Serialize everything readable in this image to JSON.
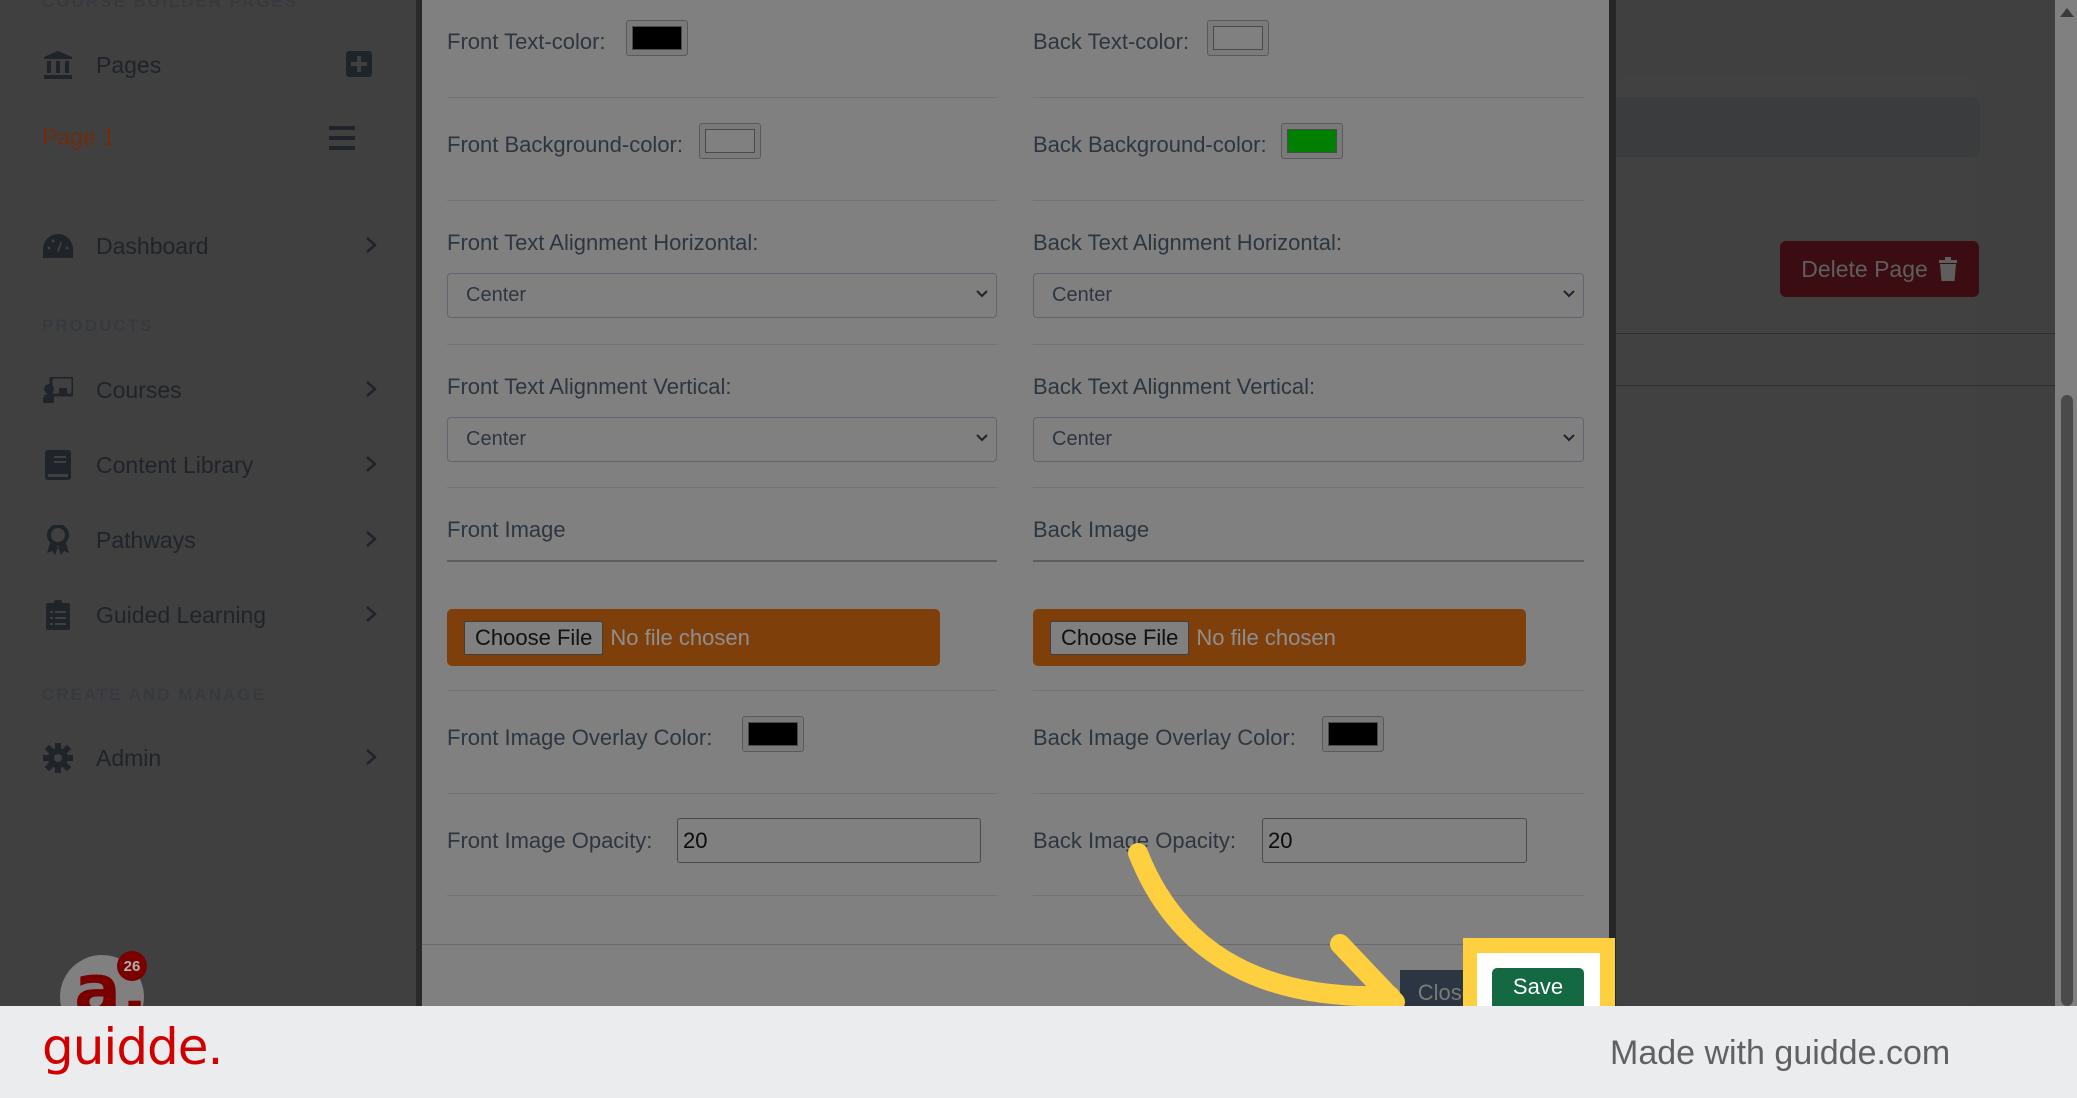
{
  "sidebar": {
    "section_course_builder": "COURSE BUILDER PAGES",
    "pages_label": "Pages",
    "page1_label": "Page 1",
    "dashboard_label": "Dashboard",
    "section_products": "PRODUCTS",
    "items": [
      {
        "label": "Courses",
        "icon": "chalkboard-teacher-icon"
      },
      {
        "label": "Content Library",
        "icon": "book-icon"
      },
      {
        "label": "Pathways",
        "icon": "award-icon"
      },
      {
        "label": "Guided Learning",
        "icon": "clipboard-list-icon"
      }
    ],
    "section_create": "CREATE AND MANAGE",
    "admin_label": "Admin",
    "notification_count": "26"
  },
  "main": {
    "delete_page_label": "Delete Page"
  },
  "modal": {
    "front": {
      "text_color_label": "Front Text-color:",
      "text_color_value": "#000000",
      "bg_color_label": "Front Background-color:",
      "bg_color_value": "#ffffff",
      "h_align_label": "Front Text Alignment Horizontal:",
      "h_align_value": "Center",
      "v_align_label": "Front Text Alignment Vertical:",
      "v_align_value": "Center",
      "image_label": "Front Image",
      "choose_file": "Choose File",
      "no_file": "No file chosen",
      "overlay_label": "Front Image Overlay Color:",
      "overlay_value": "#000000",
      "opacity_label": "Front Image Opacity:",
      "opacity_value": "20"
    },
    "back": {
      "text_color_label": "Back Text-color:",
      "text_color_value": "#ffffff",
      "bg_color_label": "Back Background-color:",
      "bg_color_value": "#00a000",
      "h_align_label": "Back Text Alignment Horizontal:",
      "h_align_value": "Center",
      "v_align_label": "Back Text Alignment Vertical:",
      "v_align_value": "Center",
      "image_label": "Back Image",
      "choose_file": "Choose File",
      "no_file": "No file chosen",
      "overlay_label": "Back Image Overlay Color:",
      "overlay_value": "#000000",
      "opacity_label": "Back Image Opacity:",
      "opacity_value": "20"
    },
    "close_label": "Close",
    "save_label": "Save"
  },
  "footer": {
    "brand": "guidde.",
    "made_with": "Made with guidde.com"
  },
  "colors": {
    "accent_highlight": "#fecf3e",
    "save_green": "#146943",
    "file_input_orange": "#7f3f0b",
    "brand_red": "#d00000"
  }
}
